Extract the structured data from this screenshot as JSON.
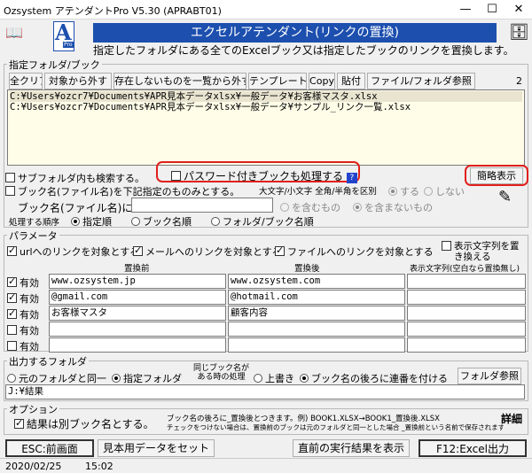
{
  "window": {
    "title": "Ozsystem アテンダントPro V5.30 (APRABT01)",
    "minimize": "—",
    "maximize": "☐",
    "close": "✕"
  },
  "header": {
    "banner": "エクセルアテンダント(リンクの置換)",
    "description": "指定したフォルダにある全てのExcelブック又は指定したブックのリンクを置換します。",
    "logo_letter": "A",
    "logo_sub": "Pro"
  },
  "folder_section": {
    "label": "指定フォルダ/ブック",
    "buttons": [
      "全クリア",
      "対象から外す",
      "存在しないものを一覧から外す",
      "テンプレート",
      "Copy",
      "貼付",
      "ファイル/フォルダ参照"
    ],
    "count": "2",
    "paths": [
      "C:¥Users¥ozcr7¥Documents¥APR見本データxlsx¥一般データ¥お客様マスタ.xlsx",
      "C:¥Users¥ozcr7¥Documents¥APR見本データxlsx¥一般データ¥サンプル_リンク一覧.xlsx"
    ],
    "subfolder_label": "サブフォルダ内も検索する。",
    "password_label": "パスワード付きブックも処理する",
    "help": "?",
    "simple_view": "簡略表示",
    "bookname_filter_label": "ブック名(ファイル名)を下記指定のものみとする。",
    "case_label": "大文字/小文字 全角/半角を区別",
    "case_yes": "する",
    "case_no": "しない",
    "bookname_in_label": "ブック名(ファイル名)に",
    "contains_label": "を含むもの",
    "not_contains_label": "を含まないもの",
    "order_label": "処理する順序",
    "order_options": [
      "指定順",
      "ブック名順",
      "フォルダ/ブック名順"
    ]
  },
  "params": {
    "label": "パラメータ",
    "url_label": "urlへのリンクを対象とする",
    "mail_label": "メールへのリンクを対象とする",
    "file_label": "ファイルへのリンクを対象とする",
    "display_text_label_1": "表示文字列を置",
    "display_text_label_2": "き換える",
    "col_before": "置換前",
    "col_after": "置換後",
    "col_display": "表示文字列(空白なら置換無し)",
    "enabled_label": "有効",
    "rows": [
      {
        "on": true,
        "before": "www.ozsystem.jp",
        "after": "www.ozsystem.com",
        "display": ""
      },
      {
        "on": true,
        "before": "@gmail.com",
        "after": "@hotmail.com",
        "display": ""
      },
      {
        "on": true,
        "before": "お客様マスタ",
        "after": "顧客内容",
        "display": ""
      },
      {
        "on": false,
        "before": "",
        "after": "",
        "display": ""
      },
      {
        "on": false,
        "before": "",
        "after": "",
        "display": ""
      }
    ]
  },
  "output": {
    "label": "出力するフォルダ",
    "same_folder": "元のフォルダと同一",
    "specified_folder": "指定フォルダ",
    "same_name_1": "同じブック名が",
    "same_name_2": "ある時の処理",
    "overwrite": "上書き",
    "append_serial": "ブック名の後ろに連番を付ける",
    "folder_ref": "フォルダ参照",
    "path": "J:¥結果"
  },
  "options": {
    "label": "オプション",
    "separate_name_label": "結果は別ブック名とする。",
    "note_1": "ブック名の後ろに_置換後とつきます。例) BOOK1.XLSX→BOOK1_置換後.XLSX",
    "note_2": "チェックをつけない場合は、置換前のブックは元のフォルダと同一とした場合 _置換前という名前で保存されます。",
    "details": "詳細"
  },
  "footer": {
    "esc": "ESC:前画面",
    "sample": "見本用データをセット",
    "prev_result": "直前の実行結果を表示",
    "f12": "F12:Excel出力"
  },
  "status": {
    "date": "2020/02/25",
    "time": "15:02"
  },
  "colors": {
    "banner": "#1c4fae",
    "textarea_bg": "#fffde8",
    "highlight_ring": "#e0201c"
  }
}
